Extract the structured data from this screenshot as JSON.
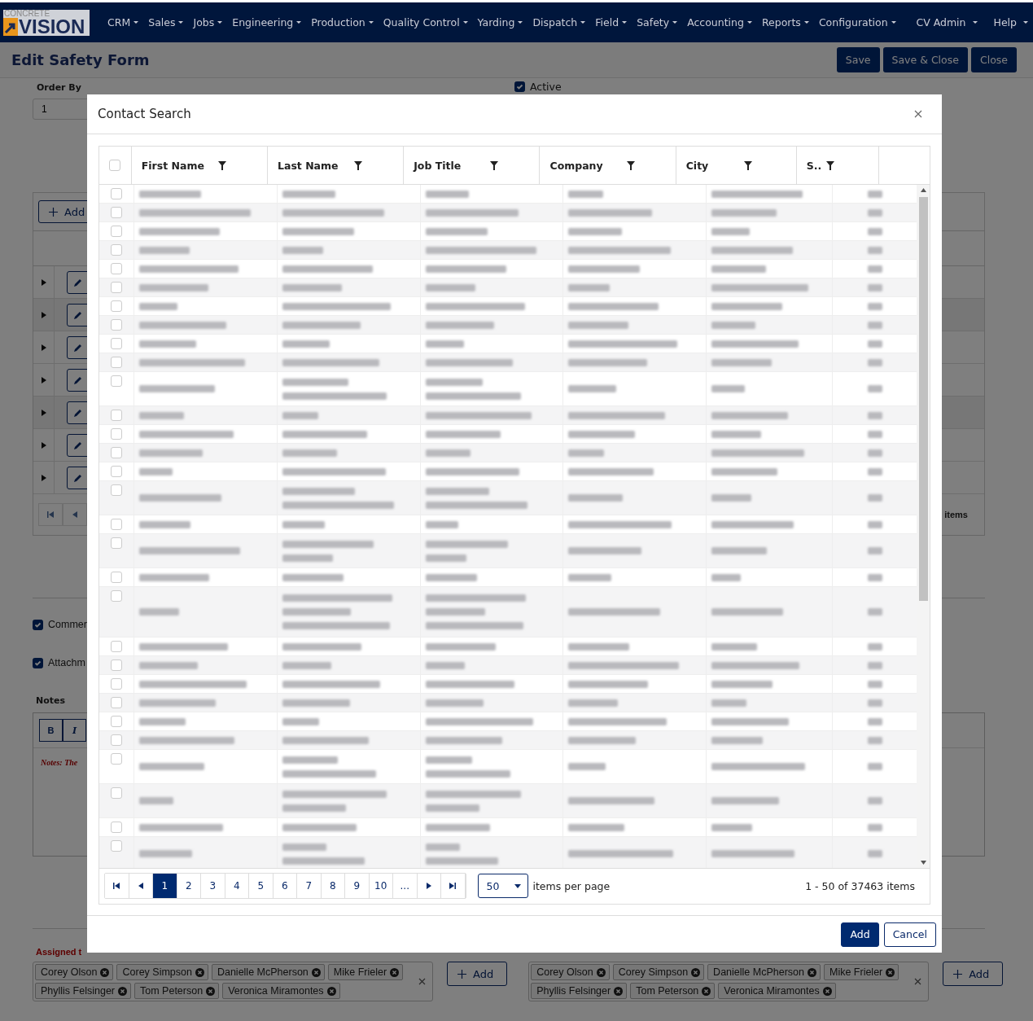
{
  "nav": {
    "logo": {
      "top": "CONCRETE",
      "main": "VISION"
    },
    "menus": [
      {
        "label": "CRM"
      },
      {
        "label": "Sales"
      },
      {
        "label": "Jobs"
      },
      {
        "label": "Engineering"
      },
      {
        "label": "Production"
      },
      {
        "label": "Quality Control"
      },
      {
        "label": "Yarding"
      },
      {
        "label": "Dispatch"
      },
      {
        "label": "Field"
      },
      {
        "label": "Safety"
      },
      {
        "label": "Accounting"
      },
      {
        "label": "Reports"
      },
      {
        "label": "Configuration"
      }
    ],
    "right_menus": [
      {
        "label": "CV Admin"
      },
      {
        "label": "Help"
      }
    ]
  },
  "page": {
    "title": "Edit Safety Form",
    "buttons": [
      "Save",
      "Save & Close",
      "Close"
    ]
  },
  "form": {
    "order_by": {
      "label": "Order By",
      "value": "1"
    },
    "active": {
      "label": "Active",
      "checked": true
    },
    "grid": {
      "add_button": "Add",
      "rows": [
        {
          "expanded": false
        },
        {
          "expanded": false
        },
        {
          "expanded": false
        },
        {
          "expanded": false
        },
        {
          "expanded": false
        },
        {
          "expanded": false
        },
        {
          "expanded": false
        }
      ],
      "pager_text": "items"
    },
    "comments": {
      "label": "Commer",
      "checked": true
    },
    "attachments": {
      "label": "Attachm",
      "checked": true
    },
    "notes": {
      "label": "Notes",
      "toolbar": [
        "B",
        "I"
      ],
      "text": "Notes: The"
    },
    "assigned": {
      "label": "Assigned t",
      "groups": [
        {
          "tags": [
            "Corey Olson",
            "Corey Simpson",
            "Danielle McPherson",
            "Mike Frieler",
            "Phyllis Felsinger",
            "Tom Peterson",
            "Veronica Miramontes"
          ],
          "add_button": "Add"
        },
        {
          "tags": [
            "Corey Olson",
            "Corey Simpson",
            "Danielle McPherson",
            "Mike Frieler",
            "Phyllis Felsinger",
            "Tom Peterson",
            "Veronica Miramontes"
          ],
          "add_button": "Add"
        }
      ]
    }
  },
  "modal": {
    "title": "Contact Search",
    "select_all": false,
    "columns": [
      {
        "label": "First Name"
      },
      {
        "label": "Last Name"
      },
      {
        "label": "Job Title"
      },
      {
        "label": "Company"
      },
      {
        "label": "City"
      },
      {
        "label": "S.."
      }
    ],
    "rows": [
      {
        "checked": false,
        "kind": "single"
      },
      {
        "checked": false,
        "kind": "single"
      },
      {
        "checked": false,
        "kind": "single"
      },
      {
        "checked": false,
        "kind": "single"
      },
      {
        "checked": false,
        "kind": "single"
      },
      {
        "checked": false,
        "kind": "single"
      },
      {
        "checked": false,
        "kind": "single"
      },
      {
        "checked": false,
        "kind": "single"
      },
      {
        "checked": false,
        "kind": "single"
      },
      {
        "checked": false,
        "kind": "single"
      },
      {
        "checked": false,
        "kind": "double"
      },
      {
        "checked": false,
        "kind": "single"
      },
      {
        "checked": false,
        "kind": "single"
      },
      {
        "checked": false,
        "kind": "single"
      },
      {
        "checked": false,
        "kind": "single"
      },
      {
        "checked": false,
        "kind": "double"
      },
      {
        "checked": false,
        "kind": "single"
      },
      {
        "checked": false,
        "kind": "double"
      },
      {
        "checked": false,
        "kind": "single"
      },
      {
        "checked": false,
        "kind": "triple"
      },
      {
        "checked": false,
        "kind": "single"
      },
      {
        "checked": false,
        "kind": "single"
      },
      {
        "checked": false,
        "kind": "single"
      },
      {
        "checked": false,
        "kind": "single"
      },
      {
        "checked": false,
        "kind": "single"
      },
      {
        "checked": false,
        "kind": "single"
      },
      {
        "checked": false,
        "kind": "double"
      },
      {
        "checked": false,
        "kind": "double"
      },
      {
        "checked": false,
        "kind": "single"
      },
      {
        "checked": false,
        "kind": "double"
      }
    ],
    "pager": {
      "pages": [
        {
          "label": "1",
          "selected": true
        },
        {
          "label": "2",
          "selected": false
        },
        {
          "label": "3",
          "selected": false
        },
        {
          "label": "4",
          "selected": false
        },
        {
          "label": "5",
          "selected": false
        },
        {
          "label": "6",
          "selected": false
        },
        {
          "label": "7",
          "selected": false
        },
        {
          "label": "8",
          "selected": false
        },
        {
          "label": "9",
          "selected": false
        },
        {
          "label": "10",
          "selected": false
        },
        {
          "label": "...",
          "selected": false
        }
      ],
      "page_size": "50",
      "page_size_label": "items per page",
      "summary": "1 - 50 of 37463 items"
    },
    "buttons": [
      {
        "label": "Add",
        "kind": "primary"
      },
      {
        "label": "Cancel",
        "kind": "secondary"
      }
    ]
  }
}
